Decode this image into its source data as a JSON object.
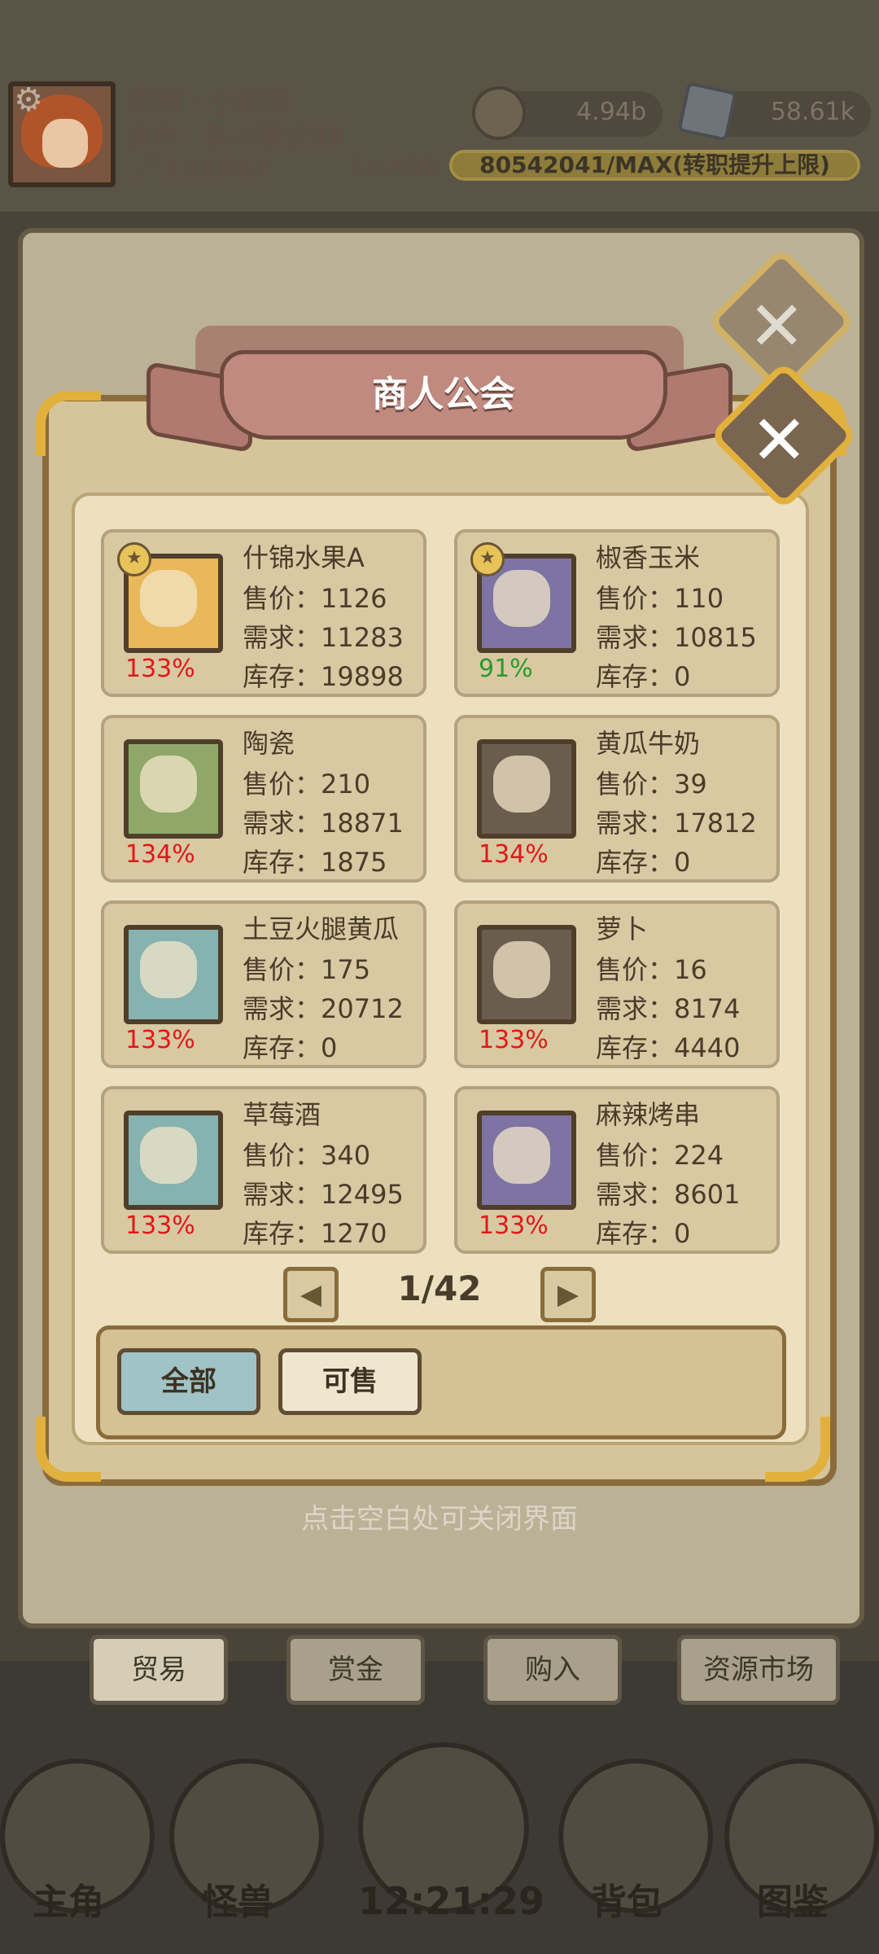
{
  "player": {
    "name": "非洲丶小趴菜",
    "title": "身份：实习镖长Ⅶ",
    "power": "131867",
    "level": "Lv.400",
    "exp_text": "80542041/MAX(转职提升上限)",
    "currency_coin": "4.94b",
    "currency_gem": "58.61k"
  },
  "dialog": {
    "title": "商人公会",
    "close_icon": "close-icon",
    "items": [
      {
        "name": "什锦水果A",
        "price": "售价：1126",
        "demand": "需求：11283",
        "stock": "库存：19898",
        "pct": "133%",
        "pct_color": "#e01818",
        "icon_bg": "#e9b85a",
        "starred": true,
        "icon": "fruit-basket-icon"
      },
      {
        "name": "椒香玉米",
        "price": "售价：110",
        "demand": "需求：10815",
        "stock": "库存：0",
        "pct": "91%",
        "pct_color": "#2a9a2a",
        "icon_bg": "#7d74a3",
        "starred": true,
        "icon": "corn-bowl-icon"
      },
      {
        "name": "陶瓷",
        "price": "售价：210",
        "demand": "需求：18871",
        "stock": "库存：1875",
        "pct": "134%",
        "pct_color": "#e01818",
        "icon_bg": "#8fa86a",
        "starred": false,
        "icon": "vase-icon"
      },
      {
        "name": "黄瓜牛奶",
        "price": "售价：39",
        "demand": "需求：17812",
        "stock": "库存：0",
        "pct": "134%",
        "pct_color": "#e01818",
        "icon_bg": "#6b5d4d",
        "starred": false,
        "icon": "milk-glass-icon"
      },
      {
        "name": "土豆火腿黄瓜",
        "price": "售价：175",
        "demand": "需求：20712",
        "stock": "库存：0",
        "pct": "133%",
        "pct_color": "#e01818",
        "icon_bg": "#86b2b0",
        "starred": false,
        "icon": "dish-icon"
      },
      {
        "name": "萝卜",
        "price": "售价：16",
        "demand": "需求：8174",
        "stock": "库存：4440",
        "pct": "133%",
        "pct_color": "#e01818",
        "icon_bg": "#6b5d4d",
        "starred": false,
        "icon": "carrot-icon"
      },
      {
        "name": "草莓酒",
        "price": "售价：340",
        "demand": "需求：12495",
        "stock": "库存：1270",
        "pct": "133%",
        "pct_color": "#e01818",
        "icon_bg": "#86b2b0",
        "starred": false,
        "icon": "wine-bottle-icon"
      },
      {
        "name": "麻辣烤串",
        "price": "售价：224",
        "demand": "需求：8601",
        "stock": "库存：0",
        "pct": "133%",
        "pct_color": "#e01818",
        "icon_bg": "#7d74a3",
        "starred": false,
        "icon": "skewer-icon"
      }
    ],
    "pager": {
      "label": "1/42"
    },
    "filters": [
      {
        "label": "全部",
        "active": true
      },
      {
        "label": "可售",
        "active": false
      }
    ],
    "hint": "点击空白处可关闭界面"
  },
  "tabs": [
    {
      "label": "贸易",
      "active": true
    },
    {
      "label": "赏金",
      "active": false
    },
    {
      "label": "购入",
      "active": false
    },
    {
      "label": "资源市场",
      "active": false
    }
  ],
  "nav": [
    {
      "label": "主角",
      "icon": "helmet-icon"
    },
    {
      "label": "怪兽",
      "icon": "monster-icon"
    },
    {
      "label": "",
      "icon": "cart-icon"
    },
    {
      "label": "背包",
      "icon": "backpack-icon"
    },
    {
      "label": "图鉴",
      "icon": "book-icon"
    }
  ],
  "clock": "12:21:29"
}
